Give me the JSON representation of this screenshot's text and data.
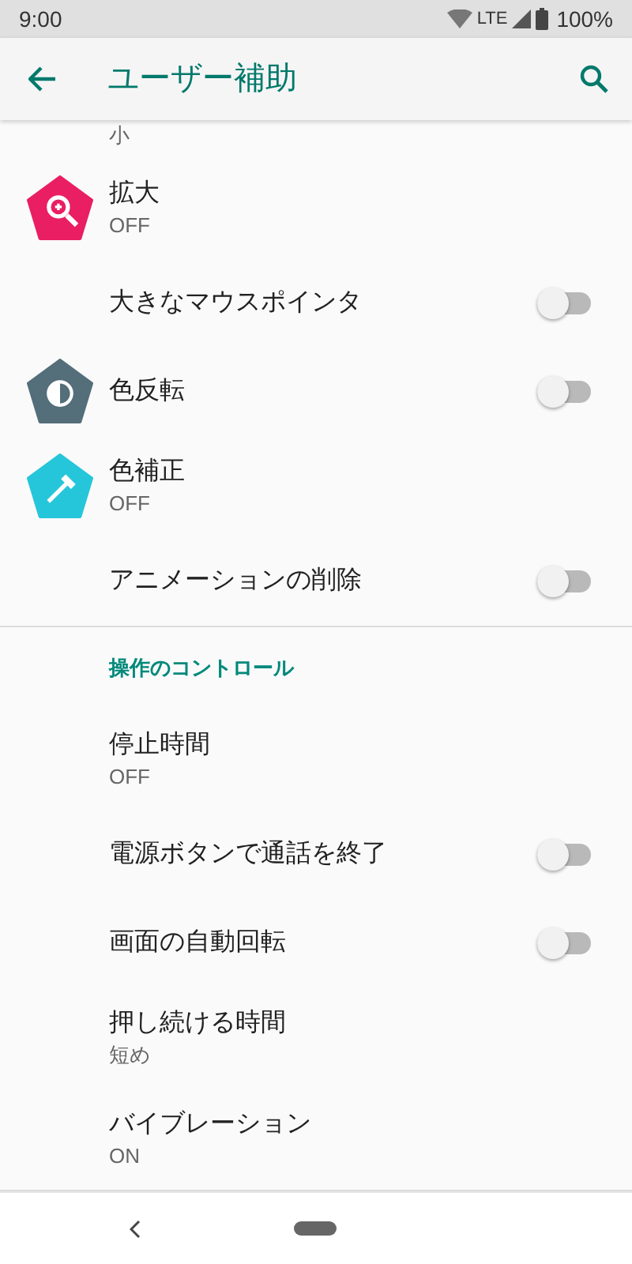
{
  "status_bar": {
    "time": "9:00",
    "network": "LTE",
    "battery": "100%"
  },
  "app_bar": {
    "title": "ユーザー補助"
  },
  "cut_summary": "小",
  "sections": [
    {
      "items": [
        {
          "kind": "text",
          "title": "拡大",
          "summary": "OFF"
        },
        {
          "kind": "toggle",
          "title": "大きなマウスポインタ",
          "on": false
        },
        {
          "kind": "toggle",
          "title": "色反転",
          "on": false
        },
        {
          "kind": "text",
          "title": "色補正",
          "summary": "OFF"
        },
        {
          "kind": "toggle",
          "title": "アニメーションの削除",
          "on": false
        }
      ]
    },
    {
      "header": "操作のコントロール",
      "items": [
        {
          "kind": "text",
          "title": "停止時間",
          "summary": "OFF"
        },
        {
          "kind": "toggle",
          "title": "電源ボタンで通話を終了",
          "on": false
        },
        {
          "kind": "toggle",
          "title": "画面の自動回転",
          "on": false
        },
        {
          "kind": "text",
          "title": "押し続ける時間",
          "summary": "短め"
        },
        {
          "kind": "text",
          "title": "バイブレーション",
          "summary": "ON"
        }
      ]
    }
  ]
}
